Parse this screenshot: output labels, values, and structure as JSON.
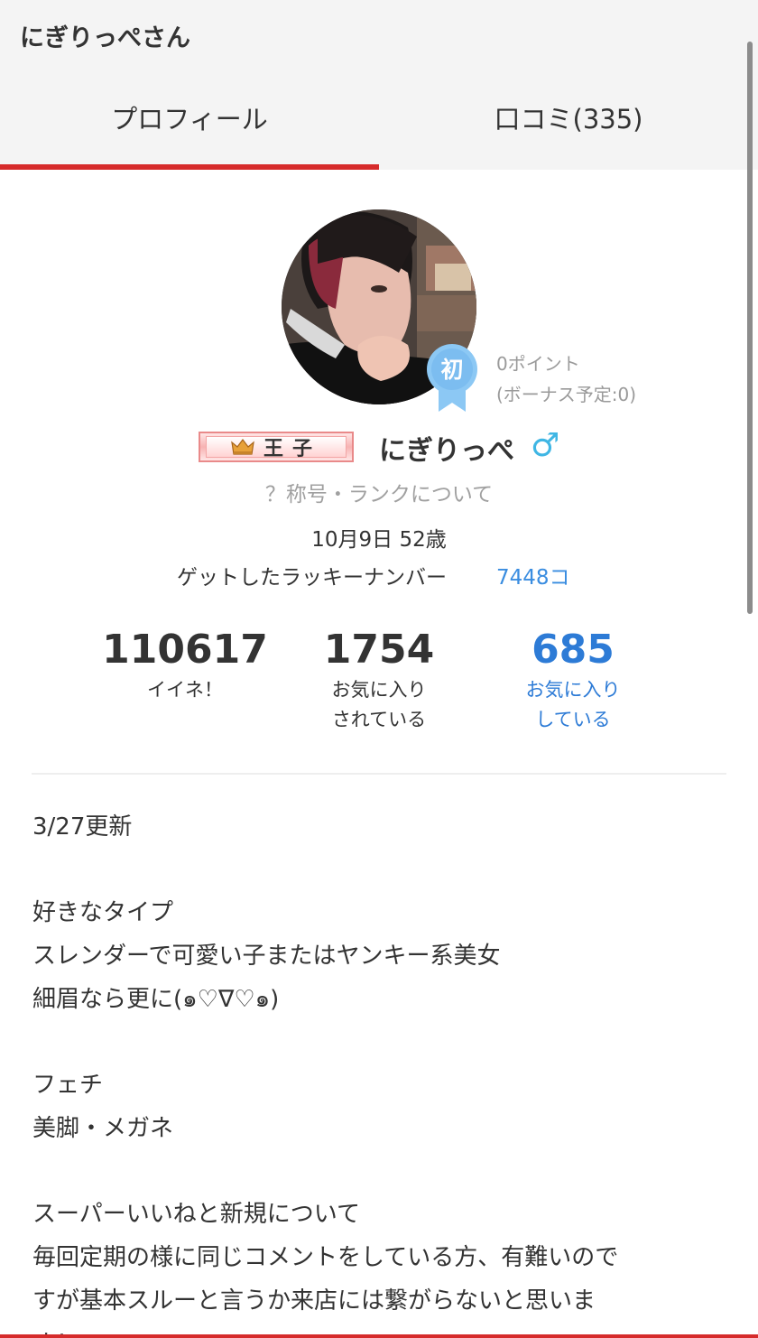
{
  "header": {
    "title": "にぎりっぺさん"
  },
  "tabs": [
    {
      "label": "プロフィール",
      "active": true
    },
    {
      "label": "口コミ(335)",
      "active": false
    }
  ],
  "colors": {
    "accent_red": "#d62b2b",
    "link_blue": "#2d7bd6",
    "badge_blue": "#8cc8f4",
    "gender_blue": "#3fb6e4"
  },
  "profile": {
    "badge_label": "初",
    "points": "0ポイント",
    "bonus": "(ボーナス予定:0)",
    "rank_label": "王子",
    "rank_icon": "crown-icon",
    "username": "にぎりっぺ",
    "gender_symbol": "♂",
    "rank_help": "？称号・ランクについて",
    "birthday": "10月9日 52歳",
    "lucky_label": "ゲットしたラッキーナンバー",
    "lucky_value": "7448コ"
  },
  "stats": [
    {
      "number": "110617",
      "label_lines": [
        "イイネ！"
      ]
    },
    {
      "number": "1754",
      "label_lines": [
        "お気に入り",
        "されている"
      ]
    },
    {
      "number": "685",
      "label_lines": [
        "お気に入り",
        "している"
      ]
    }
  ],
  "bio": {
    "lines": [
      "3/27更新",
      "",
      "好きなタイプ",
      "スレンダーで可愛い子またはヤンキー系美女",
      "細眉なら更に(๑♡∇♡๑)",
      "",
      "フェチ",
      "美脚・メガネ",
      "",
      "スーパーいいねと新規について",
      "毎回定期の様に同じコメントをしている方、有難いので",
      "すが基本スルーと言うか来店には繋がらないと思いま",
      "す！"
    ]
  }
}
